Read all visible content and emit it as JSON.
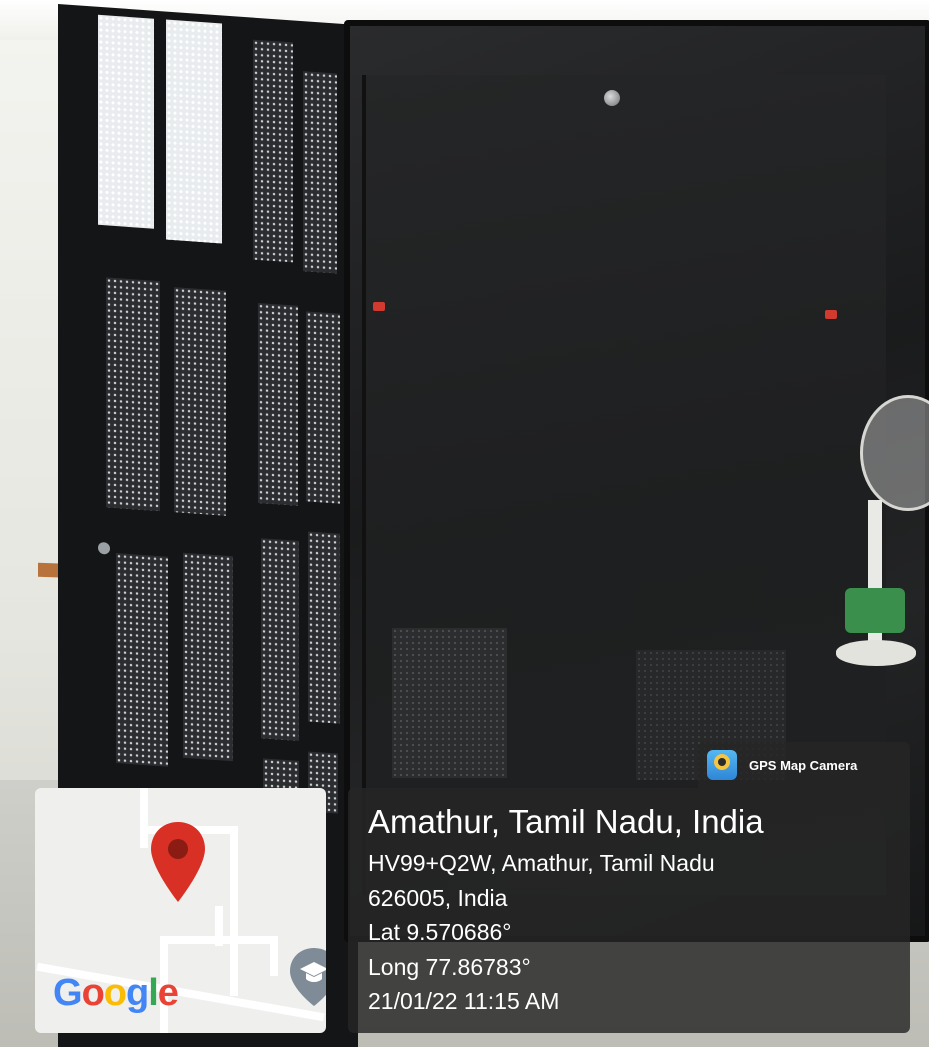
{
  "overlay": {
    "app_badge": {
      "icon": "gps-map-camera-logo",
      "label": "GPS Map Camera"
    },
    "location_title": "Amathur, Tamil Nadu, India",
    "address_line_1": "HV99+Q2W, Amathur, Tamil Nadu",
    "address_line_2": "626005, India",
    "latitude": "Lat 9.570686°",
    "longitude": "Long 77.86783°",
    "datetime": "21/01/22 11:15 AM"
  },
  "map": {
    "brand_text": "Google",
    "brand_letters": [
      "G",
      "o",
      "o",
      "g",
      "l",
      "e"
    ],
    "brand_colors": [
      "#4285F4",
      "#EA4335",
      "#FBBC05",
      "#4285F4",
      "#34A853",
      "#EA4335"
    ],
    "pin_icon": "map-pin-icon",
    "pin_color": "#D93025",
    "poi_icon": "school-graduation-cap-icon"
  },
  "colors": {
    "panel_background": "#262626",
    "panel_text": "#FFFFFF"
  }
}
